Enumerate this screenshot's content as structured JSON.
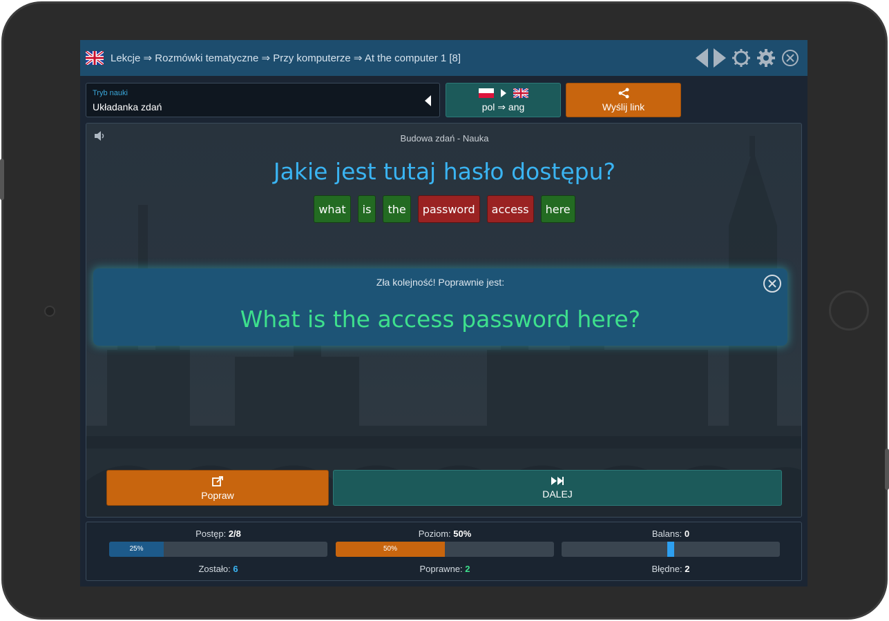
{
  "header": {
    "breadcrumb": "Lekcje ⇒ Rozmówki tematyczne ⇒ Przy komputerze ⇒ At the computer 1 [8]"
  },
  "mode": {
    "label": "Tryb nauki",
    "value": "Układanka zdań"
  },
  "language": {
    "label": "pol ⇒ ang"
  },
  "share": {
    "label": "Wyślij link"
  },
  "exercise": {
    "subtitle": "Budowa zdań - Nauka",
    "question": "Jakie jest tutaj hasło dostępu?",
    "tiles": [
      {
        "text": "what",
        "status": "correct"
      },
      {
        "text": "is",
        "status": "correct"
      },
      {
        "text": "the",
        "status": "correct"
      },
      {
        "text": "password",
        "status": "wrong"
      },
      {
        "text": "access",
        "status": "wrong"
      },
      {
        "text": "here",
        "status": "correct"
      }
    ]
  },
  "feedback": {
    "label": "Zła kolejność! Poprawnie jest:",
    "answer": "What is the access password here?"
  },
  "actions": {
    "popraw_label": "Popraw",
    "dalej_label": "DALEJ"
  },
  "stats": {
    "progress": {
      "label": "Postęp:",
      "value": "2/8",
      "bar_text": "25%",
      "fraction": 0.25
    },
    "level": {
      "label": "Poziom:",
      "value": "50%",
      "bar_text": "50%",
      "fraction": 0.5
    },
    "balance": {
      "label": "Balans:",
      "value": "0",
      "marker_position": 0.5
    },
    "remaining": {
      "label": "Zostało:",
      "value": "6"
    },
    "correct": {
      "label": "Poprawne:",
      "value": "2"
    },
    "wrong": {
      "label": "Błędne:",
      "value": "2"
    }
  },
  "colors": {
    "correct_tile": "#236b22",
    "wrong_tile": "#9a2222",
    "progress_fill": "#1d5a8a",
    "level_fill": "#c8650e",
    "answer_text": "#3ee08d",
    "question_text": "#3ab4f2"
  },
  "icons": [
    "uk-flag-icon",
    "prev-arrow-icon",
    "next-arrow-icon",
    "settings-outline-icon",
    "gear-icon",
    "close-icon",
    "pl-flag-icon",
    "share-icon",
    "speaker-icon",
    "edit-icon",
    "fast-forward-icon"
  ]
}
